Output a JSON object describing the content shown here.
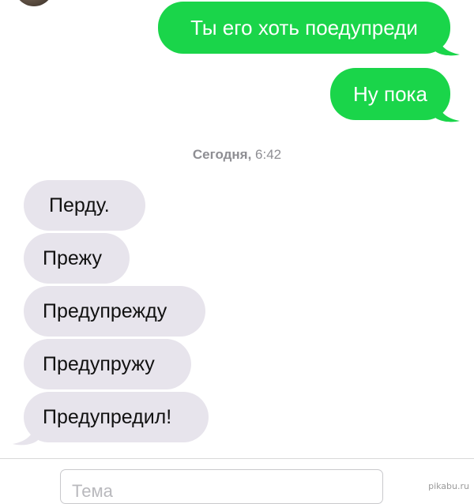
{
  "outgoing_messages": [
    "Ты его хоть поедупреди",
    "Ну пока"
  ],
  "timestamp": {
    "day": "Сегодня,",
    "time": "6:42"
  },
  "incoming_messages": [
    "Перду.",
    "Прежу",
    "Предупрежду",
    "Предупружу",
    "Предупредил!"
  ],
  "compose": {
    "subject_placeholder": "Тема"
  },
  "watermark": "pikabu.ru",
  "colors": {
    "outgoing_bubble": "#1ad54a",
    "incoming_bubble": "#e7e4ec",
    "timestamp_text": "#8e8e93"
  }
}
